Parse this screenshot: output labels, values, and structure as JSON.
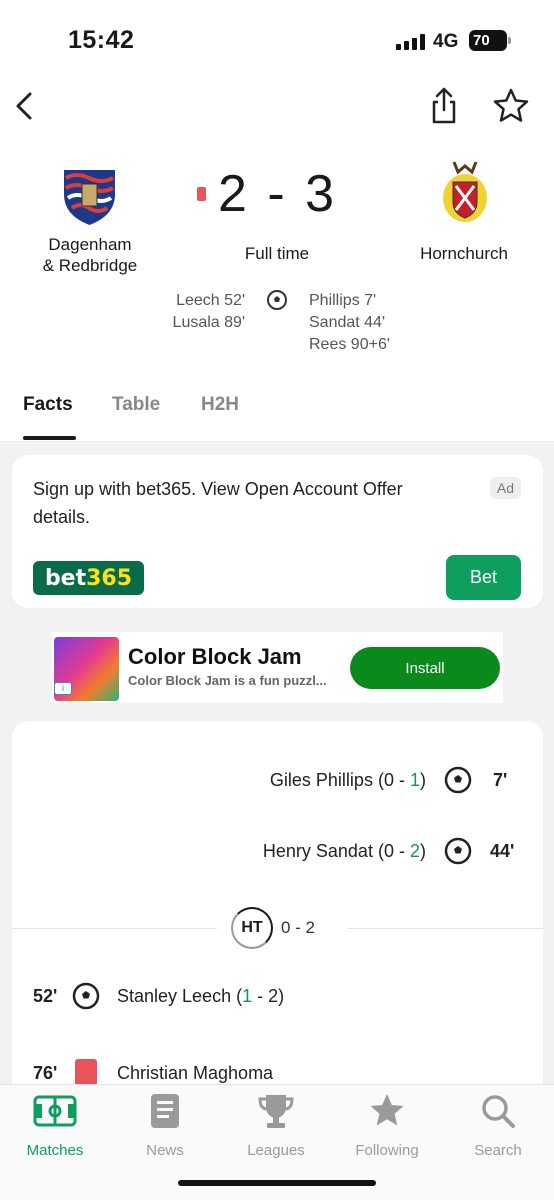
{
  "status_bar": {
    "time": "15:42",
    "network": "4G",
    "battery": "70"
  },
  "match": {
    "home_team": {
      "name": "Dagenham\n& Redbridge",
      "crest_text": "DAGENHAM & REDBRIDGE"
    },
    "away_team": {
      "name": "Hornchurch"
    },
    "score": "2 - 3",
    "status": "Full time",
    "home_scorers": [
      "Leech 52'",
      "Lusala 89'"
    ],
    "away_scorers": [
      "Phillips 7'",
      "Sandat 44'",
      "Rees 90+6'"
    ]
  },
  "tabs": [
    {
      "label": "Facts",
      "active": true
    },
    {
      "label": "Table",
      "active": false
    },
    {
      "label": "H2H",
      "active": false
    }
  ],
  "ad_card": {
    "text": "Sign up with bet365. View Open Account Offer details.",
    "badge": "Ad",
    "logo_part1": "bet",
    "logo_part2": "365",
    "button_label": "Bet"
  },
  "banner_ad": {
    "title": "Color Block Jam",
    "subtitle": "Color Block Jam is a fun puzzl...",
    "button_label": "Install"
  },
  "events": [
    {
      "player": "Giles Phillips",
      "score_pre": "(0 - ",
      "score_hl": "1",
      "score_post": ")",
      "minute": "7'"
    },
    {
      "player": "Henry Sandat",
      "score_pre": "(0 - ",
      "score_hl": "2",
      "score_post": ")",
      "minute": "44'"
    },
    {
      "player": "Stanley Leech",
      "score_pre": "(",
      "score_hl": "1",
      "score_post": " - 2)",
      "minute": "52'"
    },
    {
      "player": "Christian Maghoma",
      "minute": "76'"
    }
  ],
  "halftime": {
    "label": "HT",
    "score": "0 - 2"
  },
  "bottom_nav": [
    {
      "label": "Matches",
      "icon": "pitch-icon",
      "active": true
    },
    {
      "label": "News",
      "icon": "news-icon",
      "active": false
    },
    {
      "label": "Leagues",
      "icon": "trophy-icon",
      "active": false
    },
    {
      "label": "Following",
      "icon": "star-icon",
      "active": false
    },
    {
      "label": "Search",
      "icon": "search-icon",
      "active": false
    }
  ],
  "colors": {
    "accent_green": "#0e9f5e",
    "red_card": "#e9545a",
    "bet365_green": "#0a6b4b",
    "bet365_yellow": "#ffe014"
  }
}
